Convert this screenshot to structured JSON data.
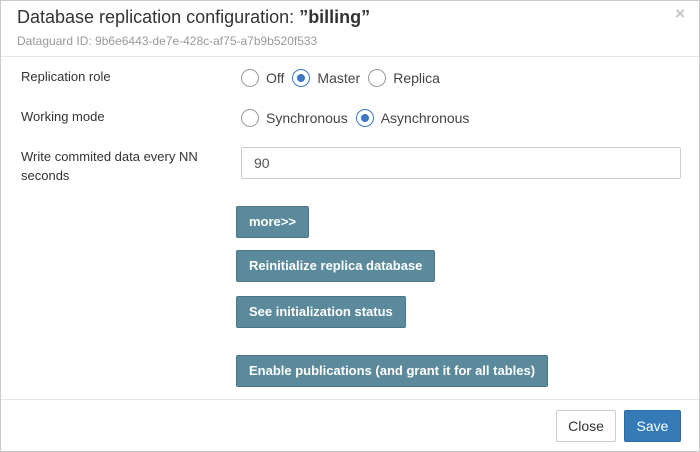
{
  "dialog": {
    "title_prefix": "Database replication configuration: ",
    "title_name": "”billing”",
    "subtitle": "Dataguard ID: 9b6e6443-de7e-428c-af75-a7b9b520f533",
    "close_glyph": "×"
  },
  "form": {
    "replication_role": {
      "label": "Replication role",
      "options": [
        "Off",
        "Master",
        "Replica"
      ],
      "selected": "Master"
    },
    "working_mode": {
      "label": "Working mode",
      "options": [
        "Synchronous",
        "Asynchronous"
      ],
      "selected": "Asynchronous"
    },
    "write_interval": {
      "label_line1": "Write commited data every NN",
      "label_line2": "seconds",
      "value": "90"
    }
  },
  "actions": {
    "more": "more>>",
    "reinitialize": "Reinitialize replica database",
    "status": "See initialization status",
    "publications": "Enable publications (and grant it for all tables)"
  },
  "footer": {
    "close_label": "Close",
    "save_label": "Save"
  },
  "colors": {
    "action_button": "#5b8a9c",
    "primary": "#337ab7",
    "radio_accent": "#3b77c6"
  }
}
